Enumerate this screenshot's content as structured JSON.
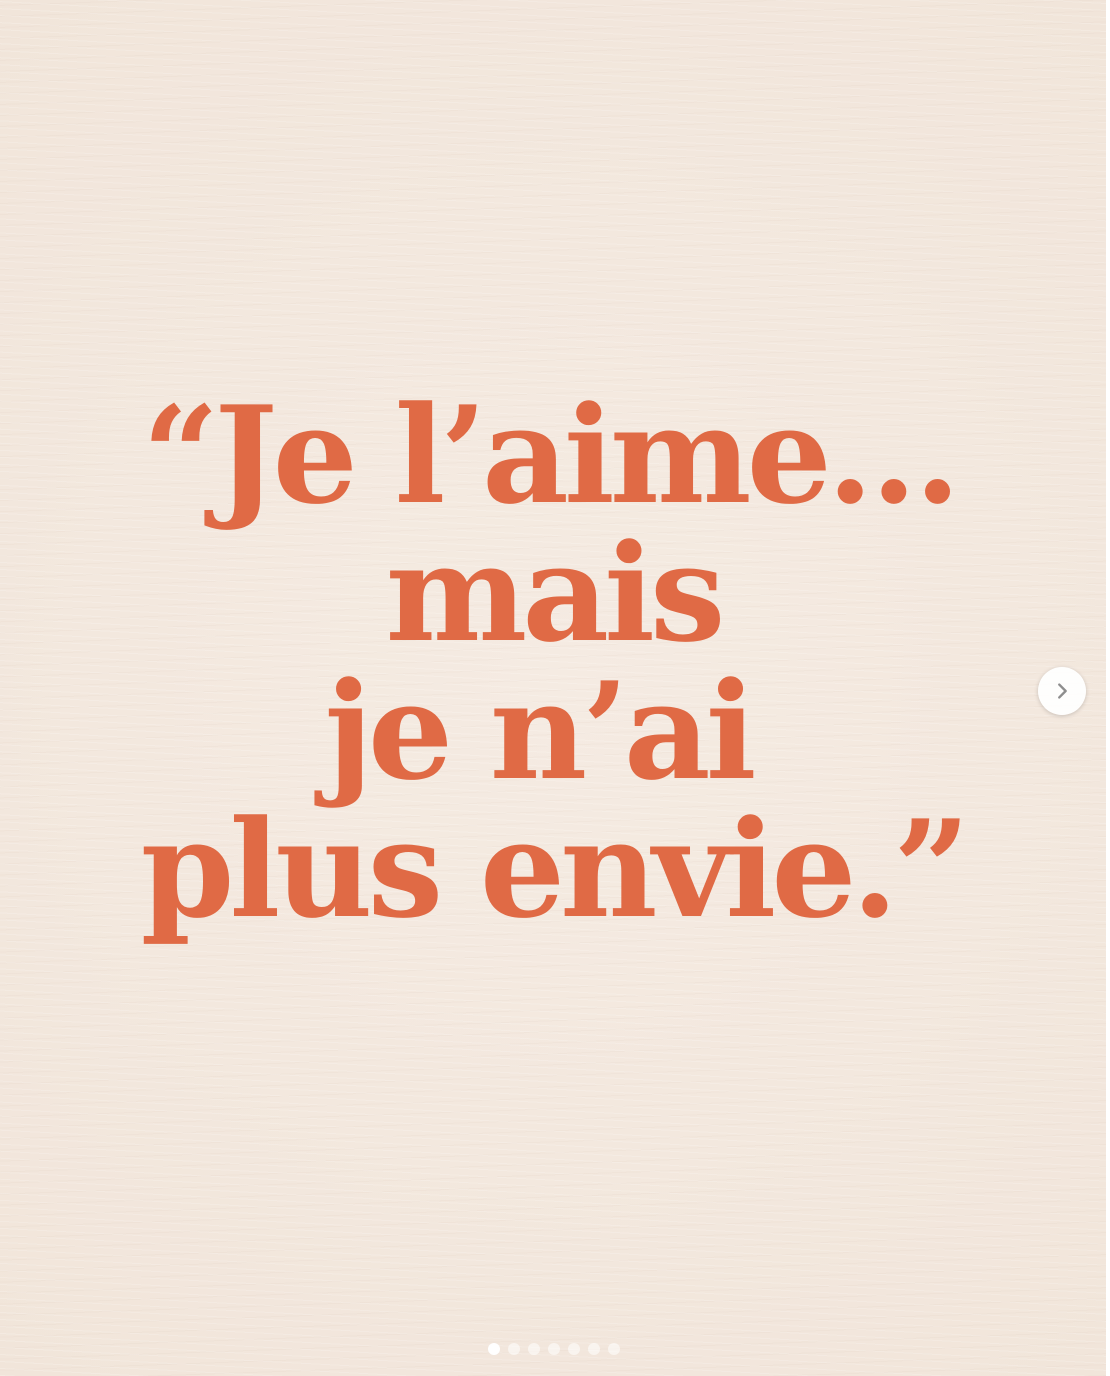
{
  "post": {
    "background_color": "#f3e8de",
    "text_color": "#e06a45",
    "quote_lines": [
      "“Je l’aime…",
      "mais",
      "je n’ai",
      "plus envie.”"
    ]
  },
  "carousel": {
    "next_icon": "chevron-right-icon",
    "total_slides": 7,
    "active_slide": 1
  }
}
